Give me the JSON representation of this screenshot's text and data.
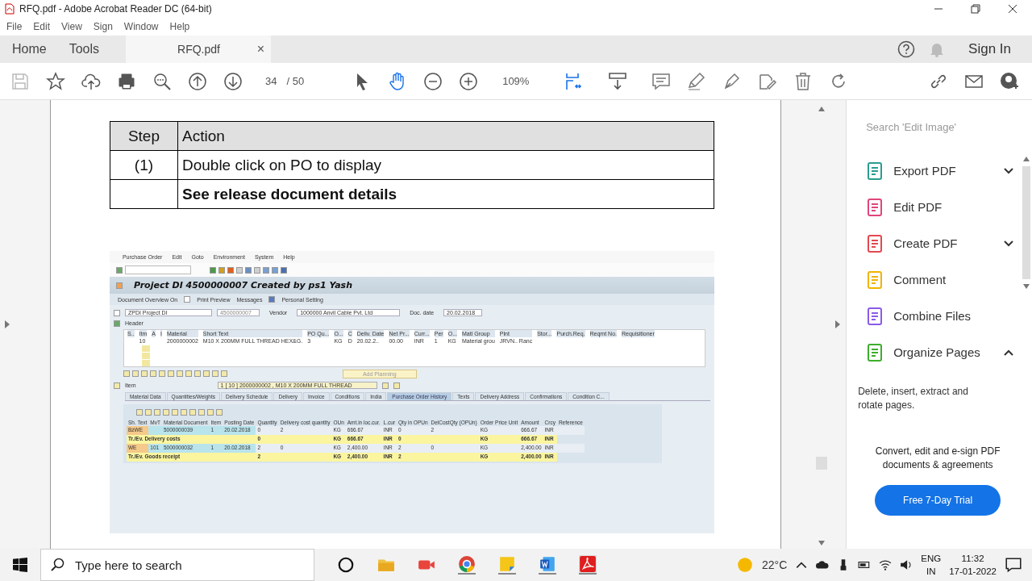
{
  "window": {
    "title": "RFQ.pdf - Adobe Acrobat Reader DC (64-bit)"
  },
  "menu": [
    "File",
    "Edit",
    "View",
    "Sign",
    "Window",
    "Help"
  ],
  "nav_tabs": [
    {
      "label": "Home",
      "selected": false
    },
    {
      "label": "Tools",
      "selected": false
    },
    {
      "label": "RFQ.pdf",
      "selected": true,
      "close": "×"
    }
  ],
  "account": {
    "sign_in": "Sign In"
  },
  "toolbar": {
    "page": "34",
    "total": "/ 50",
    "zoom": "109%"
  },
  "step_table": {
    "columns": [
      "Step",
      "Action"
    ],
    "rows": [
      {
        "step": "(1)",
        "action": "Double click on PO to display",
        "bold": false
      },
      {
        "action": "See release document details",
        "bold": true
      }
    ]
  },
  "sap": {
    "menu": [
      "Purchase Order",
      "Edit",
      "Goto",
      "Environment",
      "System",
      "Help"
    ],
    "title": "Project DI 4500000007 Created by ps1 Yash",
    "actions": [
      "Document Overview On",
      "Print Preview",
      "Messages",
      "Personal Setting"
    ],
    "doc_type": "ZPDI Project DI",
    "po_number": "4500000007",
    "vendor_label": "Vendor",
    "vendor": "1000000 Anvil Cable Pvt. Ltd",
    "doc_date_label": "Doc. date",
    "doc_date": "20.02.2018",
    "header_label": "Header",
    "item_columns": [
      "S..",
      "Itm",
      "A",
      "I",
      "Material",
      "Short Text",
      "PO Qu...",
      "O...",
      "C",
      "Deliv. Date",
      "Net Pr...",
      "Curr...",
      "Per",
      "O...",
      "Matl Group",
      "Plnt",
      "Stor...",
      "Purch.Req.",
      "Reqmt No.",
      "Requisitioner"
    ],
    "item_rows": [
      {
        "item": "10",
        "values": [
          "2000000002",
          "M10 X 200MM FULL THREAD HEX&G.",
          "3",
          "KG",
          "D",
          "20.02.2..",
          "00.00",
          "INR",
          "1",
          "KG",
          "Material grou",
          "JRVN.. Ranc"
        ]
      }
    ],
    "add_button": "Add Planning",
    "item_selector": {
      "label": "Item",
      "value": "1 [ 10 ] 2000000002 , M10 X 200MM FULL THREAD"
    },
    "tabs": [
      {
        "label": "Material Data",
        "selected": false
      },
      {
        "label": "Quantities/Weights",
        "selected": false
      },
      {
        "label": "Delivery Schedule",
        "selected": false
      },
      {
        "label": "Delivery",
        "selected": false
      },
      {
        "label": "Invoice",
        "selected": false
      },
      {
        "label": "Conditions",
        "selected": false
      },
      {
        "label": "India",
        "selected": false
      },
      {
        "label": "Purchase Order History",
        "selected": true
      },
      {
        "label": "Texts",
        "selected": false
      },
      {
        "label": "Delivery Address",
        "selected": false
      },
      {
        "label": "Confirmations",
        "selected": false
      },
      {
        "label": "Condition C...",
        "selected": false
      }
    ],
    "history_columns": [
      "Sh. Text",
      "MvT",
      "Material Document",
      "Item",
      "Posting Date",
      "Quantity",
      "Delivery cost quantity",
      "OUn",
      "Amt.in loc.cur.",
      "L.cur",
      "Qty in OPUn",
      "DelCostQty (OPUn)",
      "Order Price Unit",
      "Amount",
      "Crcy",
      "Reference"
    ],
    "history_rows": [
      {
        "kind": "entry",
        "cells": [
          "BzWE",
          null,
          "5000000039",
          "1",
          "20.02.2018",
          "0",
          "2",
          "KG",
          "666.67",
          "INR",
          "0",
          "2",
          "KG",
          "666.67",
          "INR"
        ]
      },
      {
        "kind": "total",
        "label": "Tr./Ev. Delivery costs",
        "cells": [
          "0",
          null,
          "KG",
          "666.67",
          "INR",
          "0",
          null,
          "KG",
          "666.67",
          "INR"
        ]
      },
      {
        "kind": "entry",
        "cells": [
          "WE",
          "101",
          "5000000032",
          "1",
          "20.02.2018",
          "2",
          "0",
          "KG",
          "2,400.00",
          "INR",
          "2",
          "0",
          "KG",
          "2,400.00",
          "INR"
        ]
      },
      {
        "kind": "total",
        "label": "Tr./Ev. Goods receipt",
        "cells": [
          "2",
          null,
          "KG",
          "2,400.00",
          "INR",
          "2",
          null,
          "KG",
          "2,400.00",
          "INR"
        ]
      }
    ]
  },
  "tools_panel": {
    "search": {
      "placeholder": "Search 'Edit Image'"
    },
    "items": [
      {
        "label": "Export PDF",
        "expanded": false
      },
      {
        "label": "Edit PDF"
      },
      {
        "label": "Create PDF",
        "expanded": false
      },
      {
        "label": "Comment"
      },
      {
        "label": "Combine Files"
      },
      {
        "label": "Organize Pages",
        "expanded": true
      }
    ],
    "description": "Delete, insert, extract and rotate pages.",
    "promo": "Convert, edit and e-sign PDF documents & agreements",
    "trial_button": "Free 7-Day Trial"
  },
  "taskbar": {
    "search": {
      "placeholder": "Type here to search"
    },
    "temperature": "22°C",
    "language": "ENG",
    "region": "IN",
    "time": "11:32",
    "date": "17-01-2022"
  }
}
